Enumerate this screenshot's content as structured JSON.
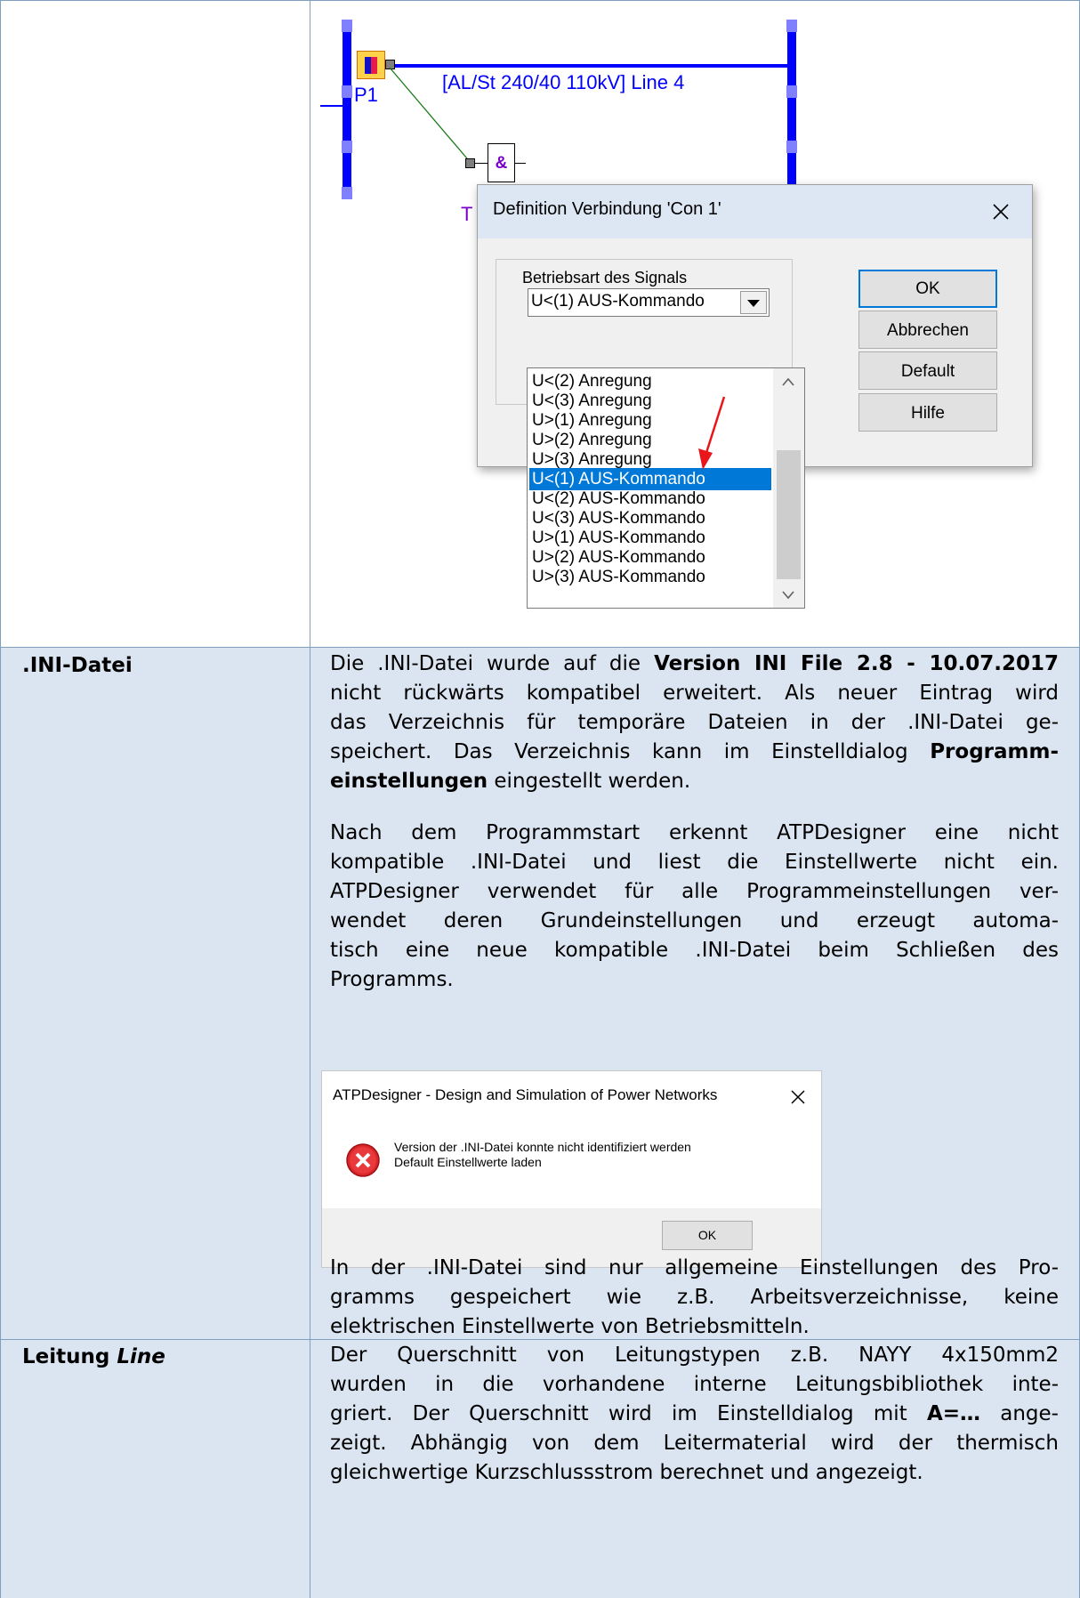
{
  "diagram": {
    "line_label": "[AL/St 240/40 110kV] Line 4",
    "p1_label": "P1",
    "and_label": "&",
    "t_label": "T"
  },
  "dialog1": {
    "title": "Definition Verbindung 'Con 1'",
    "group_label": "Betriebsart des Signals",
    "selected_value": "U<(1) AUS-Kommando",
    "buttons": [
      "OK",
      "Abbrechen",
      "Default",
      "Hilfe"
    ],
    "options": [
      "U<(2) Anregung",
      "U<(3) Anregung",
      "U>(1) Anregung",
      "U>(2) Anregung",
      "U>(3) Anregung",
      "U<(1) AUS-Kommando",
      "U<(2) AUS-Kommando",
      "U<(3) AUS-Kommando",
      "U>(1) AUS-Kommando",
      "U>(2) AUS-Kommando",
      "U>(3) AUS-Kommando"
    ],
    "selected_index": 5,
    "accent": "#0078d7"
  },
  "row_ini": {
    "label": ".INI-Datei",
    "p1": [
      [
        "Die .INI-Datei wurde auf die ",
        "Version INI File 2.8 - 10.07.2017",
        ""
      ],
      [
        "nicht rückwärts kompatibel erweitert. Als neuer Eintrag wird",
        "",
        ""
      ],
      [
        "das Verzeichnis für temporäre Dateien in der .INI-Datei ge-",
        "",
        ""
      ],
      [
        "speichert. Das Verzeichnis kann im Einstelldialog ",
        "Programm-",
        ""
      ],
      [
        "",
        "einstellungen",
        " eingestellt werden."
      ]
    ],
    "p2": [
      "Nach dem Programmstart erkennt ATPDesigner eine nicht",
      "kompatible .INI-Datei und liest die Einstellwerte nicht ein.",
      "ATPDesigner verwendet für alle Programmeinstellungen ver-",
      "wendet deren Grundeinstellungen und erzeugt automa-",
      "tisch eine neue kompatible .INI-Datei beim Schließen des",
      "Programms."
    ],
    "p3": [
      "In der .INI-Datei sind nur allgemeine Einstellungen des Pro-",
      "gramms gespeichert wie z.B. Arbeitsverzeichnisse, keine",
      "elektrischen Einstellwerte von Betriebsmitteln."
    ]
  },
  "dialog2": {
    "title": "ATPDesigner - Design and Simulation of Power Networks",
    "message_line1": "Version der .INI-Datei konnte nicht identifiziert werden",
    "message_line2": "Default Einstellwerte laden",
    "ok_label": "OK",
    "icon": "error-icon",
    "icon_color": "#e81123"
  },
  "row_line": {
    "label_bold": "Leitung ",
    "label_italic": "Line",
    "p1": [
      [
        "Der Querschnitt von Leitungstypen z.B. NAYY 4x150mm2",
        "",
        ""
      ],
      [
        "wurden in die vorhandene interne Leitungsbibliothek inte-",
        "",
        ""
      ],
      [
        "griert. Der Querschnitt wird im Einstelldialog mit ",
        "A=…",
        " ange-"
      ],
      [
        "zeigt. Abhängig von dem Leitermaterial wird der thermisch",
        "",
        ""
      ],
      [
        "gleichwertige Kurzschlussstrom berechnet und angezeigt.",
        "",
        ""
      ]
    ]
  }
}
